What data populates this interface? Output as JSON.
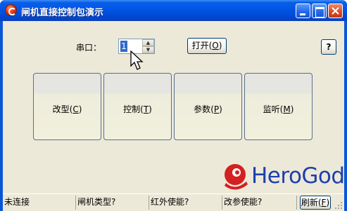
{
  "window": {
    "title": "闸机直接控制包演示"
  },
  "port": {
    "label": "串口：",
    "value": "1"
  },
  "buttons": {
    "open": {
      "text": "打开",
      "mnemonic": "O"
    },
    "help": "?",
    "modify": {
      "text": "改型",
      "mnemonic": "C"
    },
    "control": {
      "text": "控制",
      "mnemonic": "T"
    },
    "params": {
      "text": "参数",
      "mnemonic": "P"
    },
    "monitor": {
      "text": "监听",
      "mnemonic": "M"
    },
    "refresh": {
      "text": "刷新",
      "mnemonic": "F"
    }
  },
  "status": {
    "connection": "未连接",
    "gate_type": "闸机类型?",
    "infrared": "红外使能?",
    "param_change": "改参使能?"
  },
  "logo": {
    "text": "HeroGod"
  },
  "colors": {
    "titlebar": "#0055e5",
    "client": "#ece9d8",
    "logo_blue": "#1e3fae",
    "logo_red": "#d42020",
    "close_button": "#d9471f"
  },
  "icons": {
    "app": "app-icon",
    "minimize": "minimize-icon",
    "maximize": "maximize-icon",
    "close": "close-icon",
    "cursor": "mouse-pointer-icon",
    "spin_up": "chevron-up-icon",
    "spin_down": "chevron-down-icon"
  }
}
